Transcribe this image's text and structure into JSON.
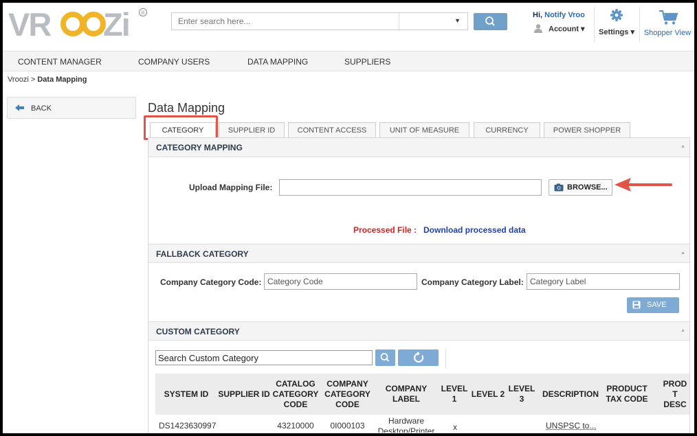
{
  "header": {
    "logo_text": "VROOZI",
    "search_placeholder": "Enter search here...",
    "greeting": "Hi,",
    "user_name": "Notify Vroo",
    "account_label": "Account ▾",
    "settings_label": "Settings ▾",
    "shopper_view_label": "Shopper View",
    "icons": [
      "search-icon",
      "user-icon",
      "gear-icon",
      "cart-icon"
    ]
  },
  "nav": {
    "items": [
      "CONTENT MANAGER",
      "COMPANY USERS",
      "DATA MAPPING",
      "SUPPLIERS"
    ]
  },
  "breadcrumb": {
    "root": "Vroozi",
    "separator": ">",
    "current": "Data Mapping"
  },
  "back_label": "BACK",
  "page_title": "Data Mapping",
  "tabs": [
    "CATEGORY",
    "SUPPLIER ID",
    "CONTENT ACCESS",
    "UNIT OF MEASURE",
    "CURRENCY",
    "POWER SHOPPER"
  ],
  "active_tab": "CATEGORY",
  "category_mapping": {
    "title": "CATEGORY MAPPING",
    "upload_label": "Upload Mapping File:",
    "upload_value": "",
    "browse_label": "BROWSE...",
    "processed_label": "Processed File :",
    "download_label": "Download processed data"
  },
  "fallback_category": {
    "title": "FALLBACK CATEGORY",
    "code_label": "Company Category Code:",
    "code_placeholder": "Category Code",
    "label_label": "Company Category Label:",
    "label_placeholder": "Category Label",
    "save_label": "SAVE"
  },
  "custom_category": {
    "title": "CUSTOM CATEGORY",
    "search_value": "Search Custom Category",
    "columns": [
      "SYSTEM ID",
      "SUPPLIER ID",
      "CATALOG CATEGORY CODE",
      "COMPANY CATEGORY CODE",
      "COMPANY LABEL",
      "LEVEL 1",
      "LEVEL 2",
      "LEVEL 3",
      "DESCRIPTION",
      "PRODUCT TAX CODE",
      "PROD T DESC"
    ],
    "rows": [
      {
        "system_id": "DS1423630997",
        "supplier_id": "",
        "catalog_category_code": "43210000",
        "company_category_code": "0I000103",
        "company_label": "Hardware Desktop/Printer",
        "level_1": "x",
        "level_2": "",
        "level_3": "",
        "description": "UNSPSC to..."
      }
    ]
  },
  "colors": {
    "accent_blue": "#6fa0c7",
    "highlight_red": "#e05545",
    "processed_red": "#e01b1b",
    "link_blue": "#1a3fbf"
  }
}
